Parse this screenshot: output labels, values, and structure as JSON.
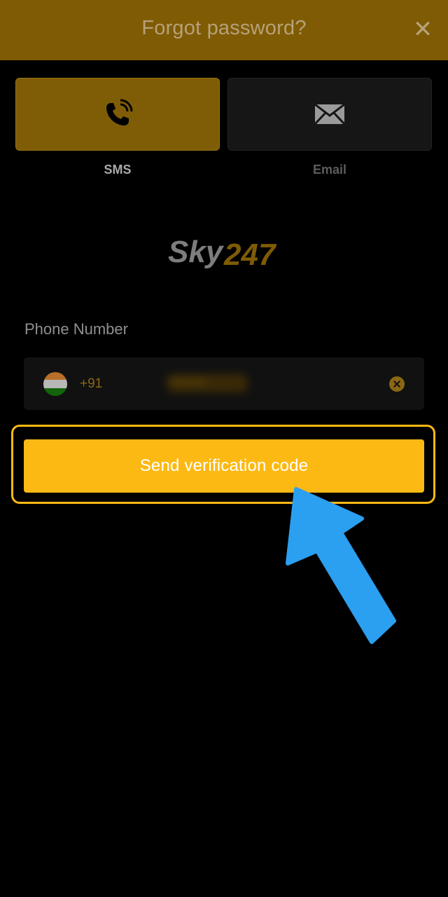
{
  "header": {
    "title": "Forgot password?"
  },
  "tabs": [
    {
      "label": "SMS",
      "icon": "phone-icon",
      "active": true
    },
    {
      "label": "Email",
      "icon": "envelope-icon",
      "active": false
    }
  ],
  "brand": {
    "logo_text": "Sky247"
  },
  "phone": {
    "label": "Phone Number",
    "country_code": "+91",
    "value": "••••••••"
  },
  "actions": {
    "send_label": "Send verification code"
  },
  "colors": {
    "accent": "#fdb913",
    "header_bg": "#7f5b04",
    "arrow": "#2b9ff0"
  }
}
